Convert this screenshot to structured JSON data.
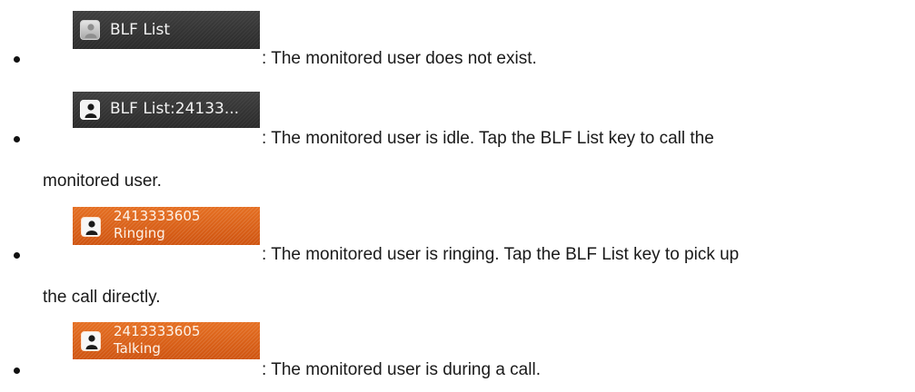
{
  "items": [
    {
      "key": {
        "style": "dark",
        "icon": "user-grey-icon",
        "label": "BLF List"
      },
      "description": ": The monitored user does not exist.",
      "continuation": ""
    },
    {
      "key": {
        "style": "dark",
        "icon": "user-white-icon",
        "label": "BLF List:24133..."
      },
      "description": ": The monitored user is idle. Tap the BLF List key to call the",
      "continuation": "monitored user."
    },
    {
      "key": {
        "style": "orange",
        "icon": "user-white-icon",
        "number": "2413333605",
        "status": "Ringing"
      },
      "description": ": The monitored user is ringing. Tap the BLF List key to pick up",
      "continuation": "the call directly."
    },
    {
      "key": {
        "style": "orange",
        "icon": "user-white-icon",
        "number": "2413333605",
        "status": "Talking"
      },
      "description": ": The monitored user is during a call.",
      "continuation": ""
    }
  ],
  "colors": {
    "dark_key": "#343434",
    "orange_key": "#dd6219",
    "text": "#1a1a1a"
  }
}
